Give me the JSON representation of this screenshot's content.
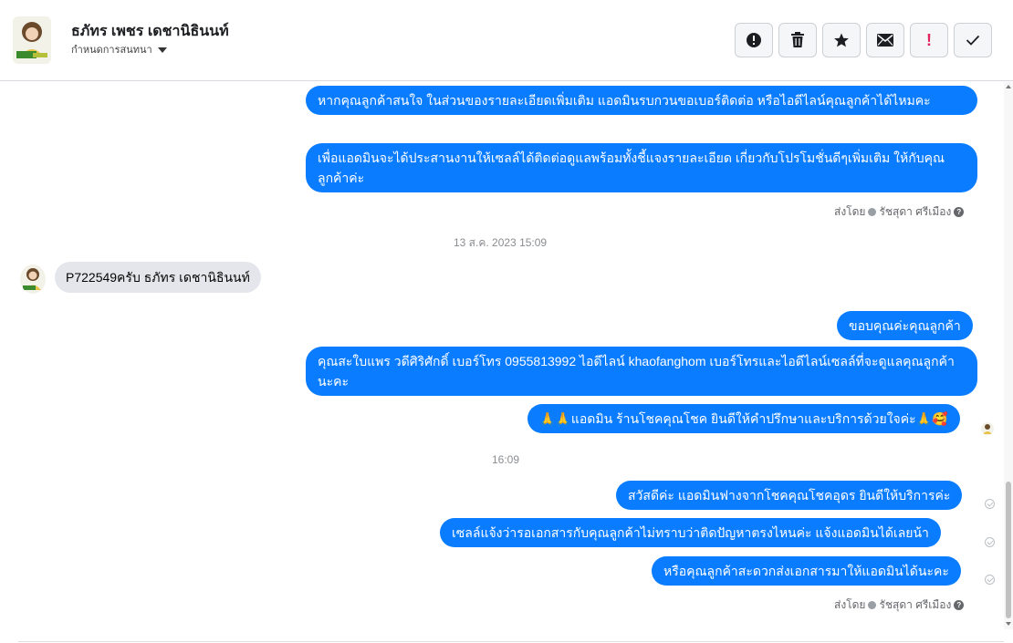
{
  "header": {
    "contact_name": "ธภัทร เพชร เดชานิธินนท์",
    "assign_label": "กำหนดการสนทนา"
  },
  "toolbar": {
    "buttons": [
      "info-alert",
      "delete",
      "star",
      "mail",
      "spam",
      "done"
    ]
  },
  "messages": {
    "out1": "หากคุณลูกค้าสนใจ ในส่วนของรายละเอียดเพิ่มเติม แอดมินรบกวนขอเบอร์ติดต่อ หรือไอดีไลน์คุณลูกค้าได้ไหมคะ",
    "out2": "เพื่อแอดมินจะได้ประสานงานให้เซลล์ได้ติดต่อดูแลพร้อมทั้งชี้แจงรายละเอียด เกี่ยวกับโปรโมชั่นดีๆเพิ่มเติม ให้กับคุณลูกค้าค่ะ",
    "sent_by_1": "ส่งโดย",
    "sender_1": "รัชสุดา ศรีเมือง",
    "timestamp_1": "13 ส.ค. 2023 15:09",
    "in1": "P722549ครับ ธภัทร เดชานิธินนท์",
    "out3": "ขอบคุณค่ะคุณลูกค้า",
    "out4": "คุณสะใบแพร วดีศิริศักดิ์ เบอร์โทร 0955813992  ไอดีไลน์  khaofanghom   เบอร์โทรและไอดีไลน์เซลล์ที่จะดูแลคุณลูกค้านะคะ",
    "out5": "🙏🙏แอดมิน ร้านโชคคุณโชค ยินดีให้คำปรึกษาและบริการด้วยใจค่ะ🙏🥰",
    "timestamp_2": "16:09",
    "out6": "สวัสดีค่ะ แอดมินฟางจากโชคคุณโชคอุดร ยินดีให้บริการค่ะ",
    "out7": "เซลล์แจ้งว่ารอเอกสารกับคุณลูกค้าไม่ทราบว่าติดปัญหาตรงไหนค่ะ  แจ้งแอดมินได้เลยน้า",
    "out8": "หรือคุณลูกค้าสะดวกส่งเอกสารมาให้แอดมินได้นะคะ",
    "sent_by_2": "ส่งโดย",
    "sender_2": "รัชสุดา ศรีเมือง",
    "help_glyph": "?"
  },
  "colors": {
    "outgoing_bubble": "#0a7cff",
    "incoming_bubble": "#e4e6eb",
    "spam_icon": "#e0245e"
  }
}
